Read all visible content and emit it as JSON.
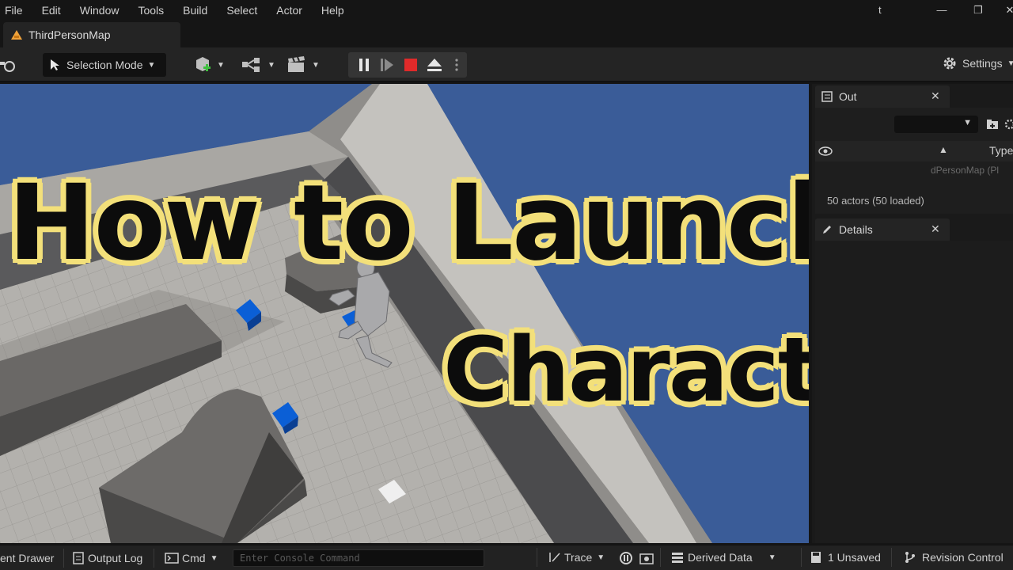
{
  "menu": [
    "File",
    "Edit",
    "Window",
    "Tools",
    "Build",
    "Select",
    "Actor",
    "Help"
  ],
  "window": {
    "user": "t",
    "minimize": "—",
    "restore": "❐",
    "close": "✕"
  },
  "tab": {
    "level_name": "ThirdPersonMap"
  },
  "toolbar": {
    "selection_mode": "Selection Mode",
    "settings": "Settings"
  },
  "outliner": {
    "tab_label": "Out",
    "type_header": "Type",
    "faded_text": "dPersonMap (Pl",
    "actor_count": "50 actors (50 loaded)"
  },
  "details": {
    "tab_label": "Details"
  },
  "statusbar": {
    "content_drawer": "ent Drawer",
    "output_log": "Output Log",
    "cmd": "Cmd",
    "console_placeholder": "Enter Console Command",
    "trace": "Trace",
    "derived_data": "Derived Data",
    "unsaved": "1 Unsaved",
    "revision_control": "Revision Control"
  },
  "overlay": {
    "line1": "How to Launch",
    "line2": "Character"
  },
  "colors": {
    "sky": "#3a5c98",
    "overlay_fill": "#0c0c0c",
    "overlay_outline": "#f3e07a",
    "stop_red": "#e02a2a",
    "cube_blue": "#0b5fd6"
  }
}
